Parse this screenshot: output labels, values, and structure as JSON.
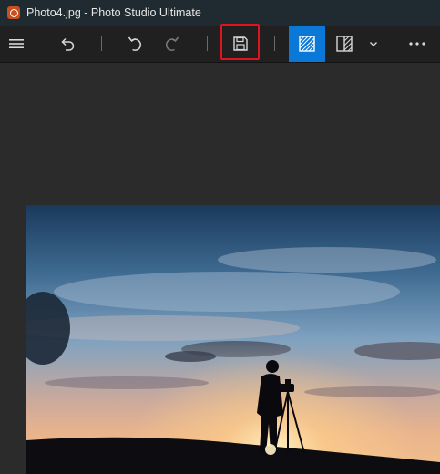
{
  "window": {
    "title": "Photo4.jpg - Photo Studio Ultimate"
  },
  "toolbar": {
    "items": [
      {
        "icon": "hamburger-menu-icon"
      },
      {
        "icon": "undo-arrow-icon"
      },
      {
        "icon": "rotate-left-icon"
      },
      {
        "icon": "rotate-right-icon"
      },
      {
        "icon": "save-icon"
      },
      {
        "icon": "enhance-icon",
        "active": true
      },
      {
        "icon": "compare-icon"
      },
      {
        "icon": "chevron-down-icon"
      },
      {
        "icon": "more-icon"
      }
    ]
  },
  "colors": {
    "accent": "#0a78d7",
    "annotation": "#e0141e",
    "titlebar": "#1f2b30",
    "toolbar": "#202020",
    "canvas": "#2b2b2b"
  }
}
